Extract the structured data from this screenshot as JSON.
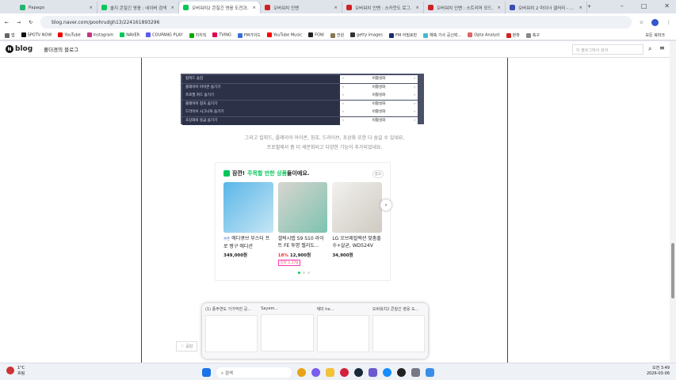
{
  "tabs": [
    {
      "title": "Papago",
      "color": "#1fb56b"
    },
    {
      "title": "솔지 콘칠긴 영웅 : 네이버 검색",
      "color": "#03c75a"
    },
    {
      "title": "오버워치2 콘칠긴 영웅 도전과...",
      "color": "#03c75a",
      "active": true
    },
    {
      "title": "오버워치 인벤",
      "color": "#c22"
    },
    {
      "title": "오버워치 인벤 : 스카웃도 로그...",
      "color": "#c22"
    },
    {
      "title": "오버워치 인벤 : 스트리머 모드...",
      "color": "#c22"
    },
    {
      "title": "오버워치 2 마이너 갤러리 - ...",
      "color": "#3b4bb0"
    }
  ],
  "url": "blog.naver.com/poohrudgh13/224161893296",
  "bookmarks": [
    "앱",
    "SPOTV NOW",
    "YouTube",
    "Instagram",
    "NAVER",
    "COUPANG PLAY",
    "치지직",
    "TVING",
    "FM가이드",
    "YouTube Music",
    "FOW",
    "전원",
    "getty images",
    "FM 어빌로만",
    "해축 기사 공신력...",
    "Opta Analyst",
    "본좌",
    "축구"
  ],
  "bookmarks_all": "모든 북마크",
  "blog": {
    "logo": "blog",
    "name": "풀더경의 블로그",
    "search_placeholder": "이 블로그에서 검색"
  },
  "settings": [
    {
      "label": "킬피드 숨김",
      "value": "비활성화"
    },
    {
      "label": "플레이어 아이콘 숨기기",
      "value": "비활성화"
    },
    {
      "label": "프로필 카드 숨기기",
      "value": "비활성화"
    },
    {
      "label": "플레이어 칭호 숨기기",
      "value": "비활성화"
    },
    {
      "label": "드라이브 시그니처 숨기기",
      "value": "비활성화"
    },
    {
      "label": "초상화의 등급 숨기기",
      "value": "비활성화"
    }
  ],
  "body": [
    "그리고 킬피드, 플레이어 아이콘, 칭호, 드라이브, 초상화 또한 다 숨길 수 있네요,",
    "프로필에서 좀 더 세분화되고 다양한 기능이 추가되었네요."
  ],
  "ad": {
    "pre": "잠깐!",
    "highlight": "주목할 만한 상품",
    "post": "들이에요.",
    "badge": "광고",
    "products": [
      {
        "name": "에디큐브 부스터 프로 짱구 에디션",
        "tag": "쿠폰",
        "price": "349,000원"
      },
      {
        "name": "갤럭시탭 S9 S10 라이트 FE 투명 젤리도...",
        "discount": "18%",
        "price": "12,900원",
        "reviews": "리뷰 1,178"
      },
      {
        "name": "LG 오브제컬렉션 맞춤출수+살균, WD524V",
        "price": "34,900원"
      }
    ]
  },
  "like": "♡ 공감",
  "switcher": [
    "(1) 풍주연도 가가막힌 공...",
    "Sayem...",
    "재미 he...",
    "오버워치2 콘칠긴 영웅 도..."
  ],
  "taskbar": {
    "weather_temp": "1°C",
    "weather_desc": "흐림",
    "search": "검색",
    "time": "오전 3:49",
    "date": "2026-03-06"
  }
}
